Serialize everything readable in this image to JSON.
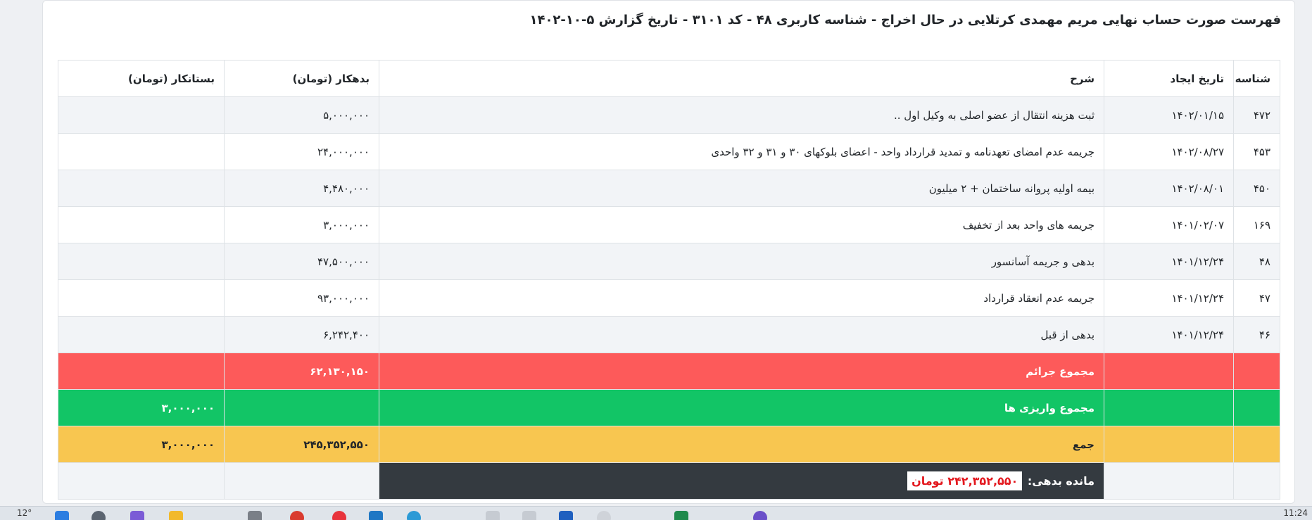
{
  "report": {
    "title": "فهرست صورت حساب نهایی مریم مهمدی کرتلایی در حال اخراج - شناسه کاربری ۴۸ - کد ۳۱۰۱ - تاریخ گزارش ۵-۱۰-۱۴۰۲"
  },
  "table": {
    "headers": {
      "id": "شناسه",
      "created": "تاریخ ایجاد",
      "desc": "شرح",
      "debit": "بدهکار (تومان)",
      "credit": "بستانکار (تومان)"
    },
    "rows": [
      {
        "id": "۴۷۲",
        "date": "۱۴۰۲/۰۱/۱۵",
        "desc": "ثبت هزینه انتقال از عضو اصلی به وکیل اول ..",
        "debit": "۵,۰۰۰,۰۰۰",
        "credit": ""
      },
      {
        "id": "۴۵۳",
        "date": "۱۴۰۲/۰۸/۲۷",
        "desc": "جریمه عدم امضای تعهدنامه و تمدید قرارداد واحد - اعضای بلوکهای ۳۰ و ۳۱ و ۳۲ واحدی",
        "debit": "۲۴,۰۰۰,۰۰۰",
        "credit": ""
      },
      {
        "id": "۴۵۰",
        "date": "۱۴۰۲/۰۸/۰۱",
        "desc": "بیمه اولیه پروانه ساختمان + ۲ میلیون",
        "debit": "۴,۴۸۰,۰۰۰",
        "credit": ""
      },
      {
        "id": "۱۶۹",
        "date": "۱۴۰۱/۰۲/۰۷",
        "desc": "جریمه های واحد بعد از تخفیف",
        "debit": "۳,۰۰۰,۰۰۰",
        "credit": ""
      },
      {
        "id": "۴۸",
        "date": "۱۴۰۱/۱۲/۲۴",
        "desc": "بدهی و جریمه آسانسور",
        "debit": "۴۷,۵۰۰,۰۰۰",
        "credit": ""
      },
      {
        "id": "۴۷",
        "date": "۱۴۰۱/۱۲/۲۴",
        "desc": "جریمه عدم انعقاد قرارداد",
        "debit": "۹۳,۰۰۰,۰۰۰",
        "credit": ""
      },
      {
        "id": "۴۶",
        "date": "۱۴۰۱/۱۲/۲۴",
        "desc": "بدهی از قبل",
        "debit": "۶,۲۴۲,۴۰۰",
        "credit": ""
      }
    ],
    "total_fines": {
      "label": "مجموع جرائم",
      "debit": "۶۲,۱۳۰,۱۵۰"
    },
    "total_payments": {
      "label": "مجموع واریزی ها",
      "credit": "۳,۰۰۰,۰۰۰"
    },
    "sum": {
      "label": "جمع",
      "debit": "۲۴۵,۳۵۲,۵۵۰",
      "credit": "۳,۰۰۰,۰۰۰"
    },
    "balance": {
      "label": "مانده بدهی:",
      "value": "۲۴۲,۳۵۲,۵۵۰ تومان"
    }
  },
  "taskbar": {
    "weather": "12°",
    "clock": "11:24"
  },
  "colors": {
    "fines_row": "#fd5a5a",
    "payments_row": "#12c566",
    "sum_row": "#f8c650",
    "balance_bg": "#343a40",
    "balance_value": "#e3181e"
  }
}
